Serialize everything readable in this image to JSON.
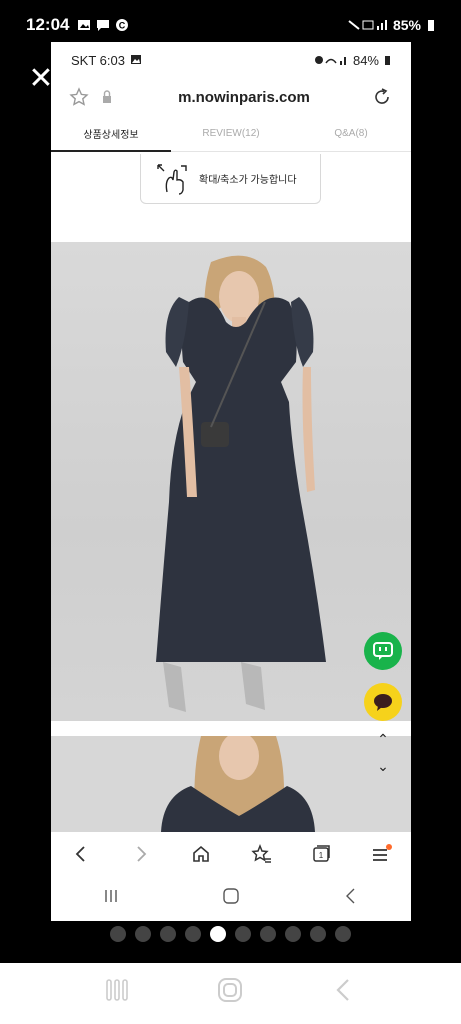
{
  "outer_status": {
    "time": "12:04",
    "battery": "85%"
  },
  "inner_status": {
    "carrier_time": "SKT 6:03",
    "battery": "84%"
  },
  "browser": {
    "url": "m.nowinparis.com"
  },
  "tabs": [
    {
      "label": "상품상세정보",
      "active": true
    },
    {
      "label": "REVIEW(12)",
      "active": false
    },
    {
      "label": "Q&A(8)",
      "active": false
    }
  ],
  "zoom_hint": "확대/축소가 가능합니다",
  "page_indicator": {
    "total": 10,
    "active_index": 4
  },
  "colors": {
    "kakao_green": "#19b34b",
    "kakao_yellow": "#f6d21b",
    "menu_dot": "#ff6a2b"
  },
  "icons": [
    "close-icon",
    "star-icon",
    "lock-icon",
    "refresh-icon",
    "back-icon",
    "forward-icon",
    "home-icon",
    "bookmarks-icon",
    "tabs-icon",
    "menu-icon",
    "recents-icon",
    "home-button-icon",
    "system-back-icon"
  ]
}
